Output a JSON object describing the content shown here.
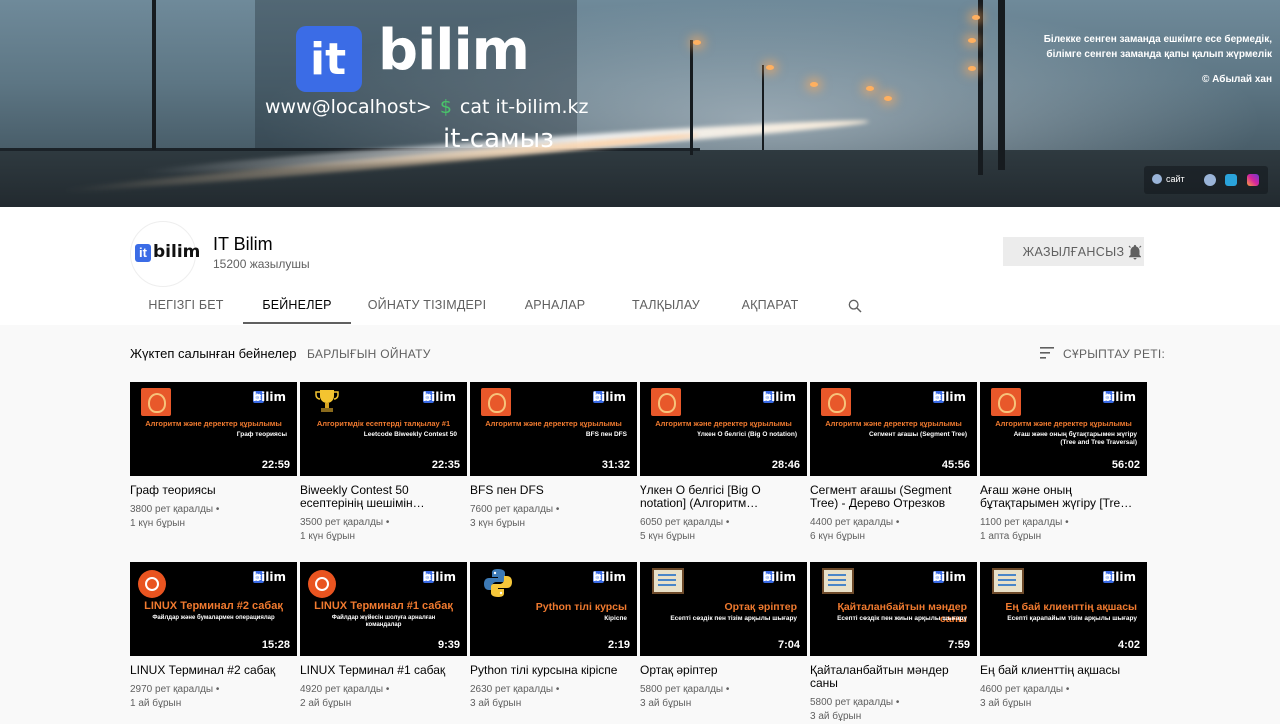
{
  "banner": {
    "brand": "bilim",
    "logo_letter": "it",
    "cmd_prompt": "www@localhost>",
    "cmd_dollar": "$",
    "cmd_text": "cat it-bilim.kz",
    "slogan": "it-самыз",
    "quote_line1": "Білекке сенген заманда ешкімге есе бермедік,",
    "quote_line2": "білімге сенген заманда қапы қалып жүрмелік",
    "quote_author": "© Абылай хан",
    "link_site": "сайт",
    "icons": [
      "globe-icon",
      "telegram-icon",
      "instagram-icon"
    ]
  },
  "channel": {
    "avatar_letter": "it",
    "avatar_text": "bilim",
    "name": "IT Bilim",
    "subscribers": "15200 жазылушы",
    "subscribe_label": "ЖАЗЫЛҒАНСЫЗ",
    "bell_icon": "bell-icon"
  },
  "tabs": [
    {
      "label": "НЕГІЗГІ БЕТ",
      "active": false
    },
    {
      "label": "БЕЙНЕЛЕР",
      "active": true
    },
    {
      "label": "ОЙНАТУ ТІЗІМДЕРІ",
      "active": false
    },
    {
      "label": "АРНАЛАР",
      "active": false
    },
    {
      "label": "ТАЛҚЫЛАУ",
      "active": false
    },
    {
      "label": "АҚПАРАТ",
      "active": false
    }
  ],
  "section": {
    "title": "Жүктеп салынған бейнелер",
    "play_all": "БАРЛЫҒЫН ОЙНАТУ",
    "sort_label": "СҰРЫПТАУ РЕТІ:"
  },
  "colors": {
    "accent_blue": "#3b6ce6",
    "thumb_orange": "#f07a2f"
  },
  "videos": [
    {
      "title": "Граф теориясы",
      "views": "3800 рет қаралды •",
      "age": "1 күн бұрын",
      "duration": "22:59",
      "thumb_l1": "Алгоритм және деректер құрылымы",
      "thumb_l2": "Граф теориясы"
    },
    {
      "title": "Biweekly Contest 50 есептерінің шешімін…",
      "views": "3500 рет қаралды •",
      "age": "1 күн бұрын",
      "duration": "22:35",
      "thumb_l1": "Алгоритмдік есептерді талқылау #1",
      "thumb_l2": "Leetcode Biweekly Contest 50"
    },
    {
      "title": "BFS пен DFS",
      "views": "7600 рет қаралды •",
      "age": "3 күн бұрын",
      "duration": "31:32",
      "thumb_l1": "Алгоритм және деректер құрылымы",
      "thumb_l2": "BFS пен DFS"
    },
    {
      "title": "Үлкен O белгісі [Big O notation] (Алгоритм…",
      "views": "6050 рет қаралды •",
      "age": "5 күн бұрын",
      "duration": "28:46",
      "thumb_l1": "Алгоритм және деректер құрылымы",
      "thumb_l2": "Үлкен O белгісі (Big O notation)"
    },
    {
      "title": "Сегмент ағашы (Segment Tree) - Дерево Отрезков",
      "views": "4400 рет қаралды •",
      "age": "6 күн бұрын",
      "duration": "45:56",
      "thumb_l1": "Алгоритм және деректер құрылымы",
      "thumb_l2": "Сегмент ағашы (Segment Tree)"
    },
    {
      "title": "Ағаш және оның бұтақтарымен жүгіру [Tre…",
      "views": "1100 рет қаралды •",
      "age": "1 апта бұрын",
      "duration": "56:02",
      "thumb_l1": "Алгоритм және деректер құрылымы",
      "thumb_l2": "Ағаш және оның бұтақтарымен жүгіру",
      "thumb_l3": "(Tree and Tree Traversal)"
    },
    {
      "title": "LINUX Терминал #2 сабақ",
      "views": "2970 рет қаралды •",
      "age": "1 ай бұрын",
      "duration": "15:28",
      "thumb_l1": "LINUX Терминал #2 сабақ",
      "thumb_l2": "Файлдар және бумалармен операциялар"
    },
    {
      "title": "LINUX Терминал #1 сабақ",
      "views": "4920 рет қаралды •",
      "age": "2 ай бұрын",
      "duration": "9:39",
      "thumb_l1": "LINUX Терминал #1 сабақ",
      "thumb_l2": "Файлдар жүйесін шолуға арналған",
      "thumb_l3": "командалар"
    },
    {
      "title": "Python тілі курсына кіріспе",
      "views": "2630 рет қаралды •",
      "age": "3 ай бұрын",
      "duration": "2:19",
      "thumb_l1": "Python тілі курсы",
      "thumb_l2": "Кіріспе"
    },
    {
      "title": "Ортақ әріптер",
      "views": "5800 рет қаралды •",
      "age": "3 ай бұрын",
      "duration": "7:04",
      "thumb_l1": "Ортақ әріптер",
      "thumb_l2": "Есепті сөздік пен тізім арқылы шығару"
    },
    {
      "title": "Қайталанбайтын мәндер саны",
      "views": "5800 рет қаралды •",
      "age": "3 ай бұрын",
      "duration": "7:59",
      "thumb_l1": "Қайталанбайтын мәндер саны",
      "thumb_l2": "Есепті сөздік пен жиын арқылы шығару"
    },
    {
      "title": "Ең бай клиенттің ақшасы",
      "views": "4600 рет қаралды •",
      "age": "3 ай бұрын",
      "duration": "4:02",
      "thumb_l1": "Ең бай клиенттің ақшасы",
      "thumb_l2": "Есепті қарапайым тізім арқылы шығару"
    }
  ],
  "thumb_brand": {
    "letter": "it",
    "text": "bilim"
  }
}
